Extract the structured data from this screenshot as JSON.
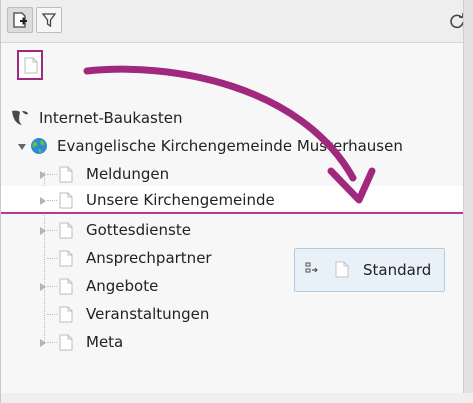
{
  "toolbar": {
    "new_page_icon": "new-page-icon",
    "filter_icon": "filter-icon",
    "refresh_icon": "refresh-icon"
  },
  "drag_source": {
    "icon": "page-icon"
  },
  "tree": {
    "root": {
      "label": "Internet-Baukasten",
      "icon": "typo3-logo-icon"
    },
    "site": {
      "label": "Evangelische Kirchengemeinde Musterhausen",
      "icon": "globe-icon"
    },
    "pages": [
      {
        "label": "Meldungen"
      },
      {
        "label": "Unsere Kirchengemeinde"
      },
      {
        "label": "Gottesdienste"
      },
      {
        "label": "Ansprechpartner"
      },
      {
        "label": "Angebote"
      },
      {
        "label": "Veranstaltungen"
      },
      {
        "label": "Meta"
      }
    ]
  },
  "drag_tooltip": {
    "label": "Standard",
    "icon": "drag-handle-icon"
  },
  "colors": {
    "accent": "#a0297e",
    "selection_line": "#b23d99",
    "globe": "#2d8bd3",
    "tooltip_bg": "#e8f0f8"
  }
}
